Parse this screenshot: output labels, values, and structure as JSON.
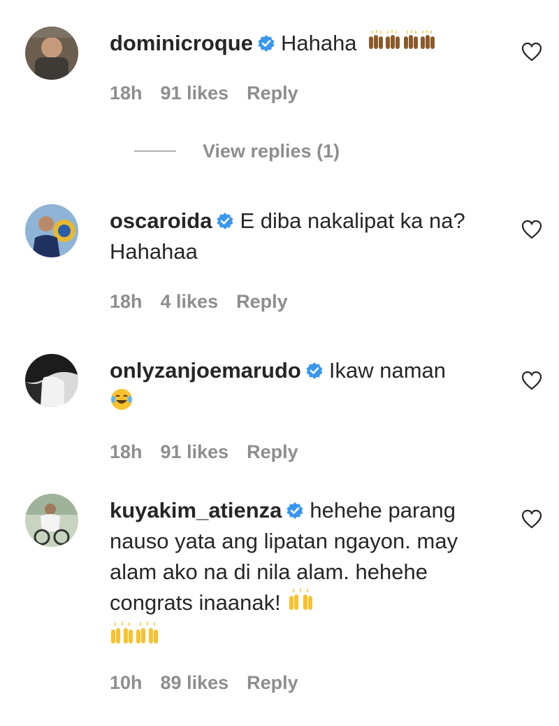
{
  "comments": [
    {
      "username": "dominicroque",
      "text": "Hahaha",
      "emoji": [
        "raised-hands-dark",
        "raised-hands-dark"
      ],
      "time": "18h",
      "likes": "91 likes",
      "reply": "Reply"
    },
    {
      "username": "oscaroida",
      "text": "E diba nakalipat ka na? Hahahaa",
      "time": "18h",
      "likes": "4 likes",
      "reply": "Reply"
    },
    {
      "username": "onlyzanjoemarudo",
      "text": "Ikaw naman",
      "emoji": [
        "face-with-tears-of-joy"
      ],
      "time": "18h",
      "likes": "91 likes",
      "reply": "Reply"
    },
    {
      "username": "kuyakim_atienza",
      "text": "hehehe parang nauso yata ang lipatan ngayon. may alam ako na di nila alam. hehehe congrats inaanak!",
      "emoji": [
        "raised-hands",
        "raised-hands",
        "raised-hands"
      ],
      "time": "10h",
      "likes": "89 likes",
      "reply": "Reply"
    }
  ],
  "view_replies": "View replies (1)",
  "colors": {
    "text": "#262626",
    "meta": "#8e8e8e",
    "verified": "#3897f0",
    "emoji_yellow": "#f7c22e",
    "emoji_dark": "#8a5a2b"
  }
}
